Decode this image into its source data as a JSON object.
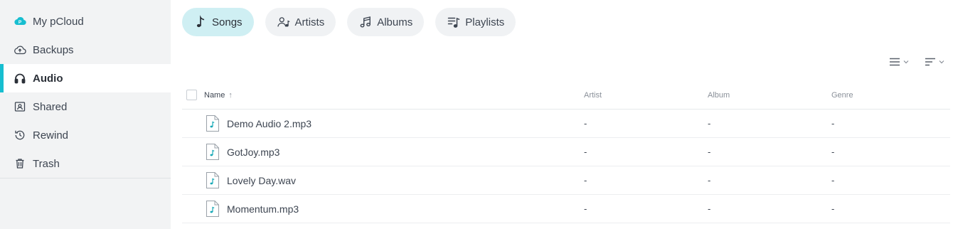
{
  "sidebar": {
    "items": [
      {
        "label": "My pCloud",
        "icon": "pcloud-cloud-icon",
        "active": false
      },
      {
        "label": "Backups",
        "icon": "cloud-upload-icon",
        "active": false
      },
      {
        "label": "Audio",
        "icon": "headphones-icon",
        "active": true
      },
      {
        "label": "Shared",
        "icon": "shared-folder-icon",
        "active": false
      },
      {
        "label": "Rewind",
        "icon": "history-icon",
        "active": false
      },
      {
        "label": "Trash",
        "icon": "trash-icon",
        "active": false
      }
    ]
  },
  "tabs": [
    {
      "label": "Songs",
      "icon": "music-note-icon",
      "active": true
    },
    {
      "label": "Artists",
      "icon": "artist-icon",
      "active": false
    },
    {
      "label": "Albums",
      "icon": "album-notes-icon",
      "active": false
    },
    {
      "label": "Playlists",
      "icon": "playlist-icon",
      "active": false
    }
  ],
  "view_controls": {
    "view_icon": "list-view-icon",
    "sort_icon": "sort-icon"
  },
  "table": {
    "headers": {
      "name": "Name",
      "artist": "Artist",
      "album": "Album",
      "genre": "Genre"
    },
    "sort_indicator": "↑",
    "rows": [
      {
        "name": "Demo Audio 2.mp3",
        "artist": "-",
        "album": "-",
        "genre": "-"
      },
      {
        "name": "GotJoy.mp3",
        "artist": "-",
        "album": "-",
        "genre": "-"
      },
      {
        "name": "Lovely Day.wav",
        "artist": "-",
        "album": "-",
        "genre": "-"
      },
      {
        "name": "Momentum.mp3",
        "artist": "-",
        "album": "-",
        "genre": "-"
      }
    ]
  },
  "colors": {
    "accent": "#17bed0",
    "active_tab_bg": "#cfeff3",
    "sidebar_bg": "#f2f3f4",
    "text": "#3d4551",
    "muted": "#8a9099"
  }
}
